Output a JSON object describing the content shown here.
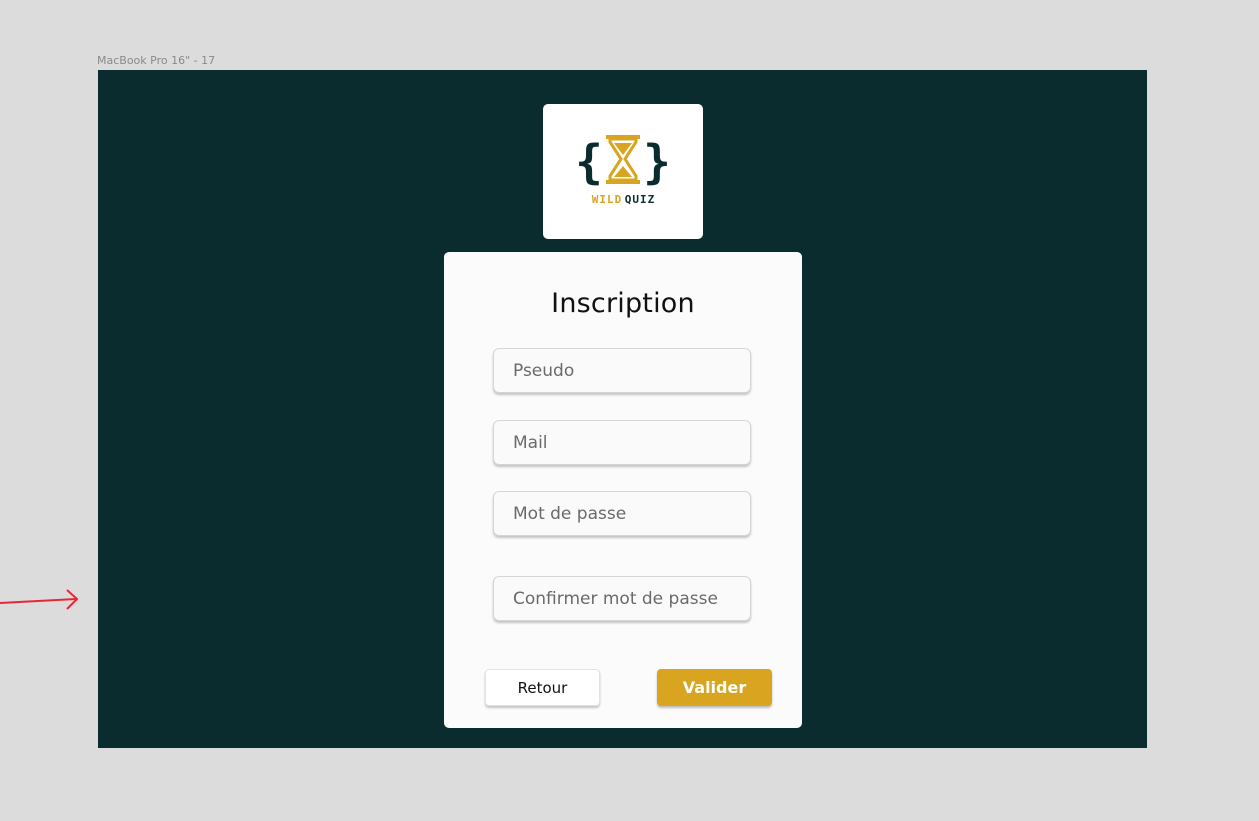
{
  "canvas": {
    "frame_label": "MacBook Pro 16\" - 17"
  },
  "logo": {
    "word_left": "WILD",
    "word_right": "QUIZ"
  },
  "form": {
    "title": "Inscription",
    "fields": [
      {
        "placeholder": "Pseudo"
      },
      {
        "placeholder": "Mail"
      },
      {
        "placeholder": "Mot de passe"
      },
      {
        "placeholder": "Confirmer mot de passe"
      }
    ],
    "back_label": "Retour",
    "submit_label": "Valider"
  },
  "colors": {
    "background": "#0b2c2e",
    "accent": "#d9a520",
    "canvas": "#dcdcdc",
    "annotation_arrow": "#e8263a"
  }
}
